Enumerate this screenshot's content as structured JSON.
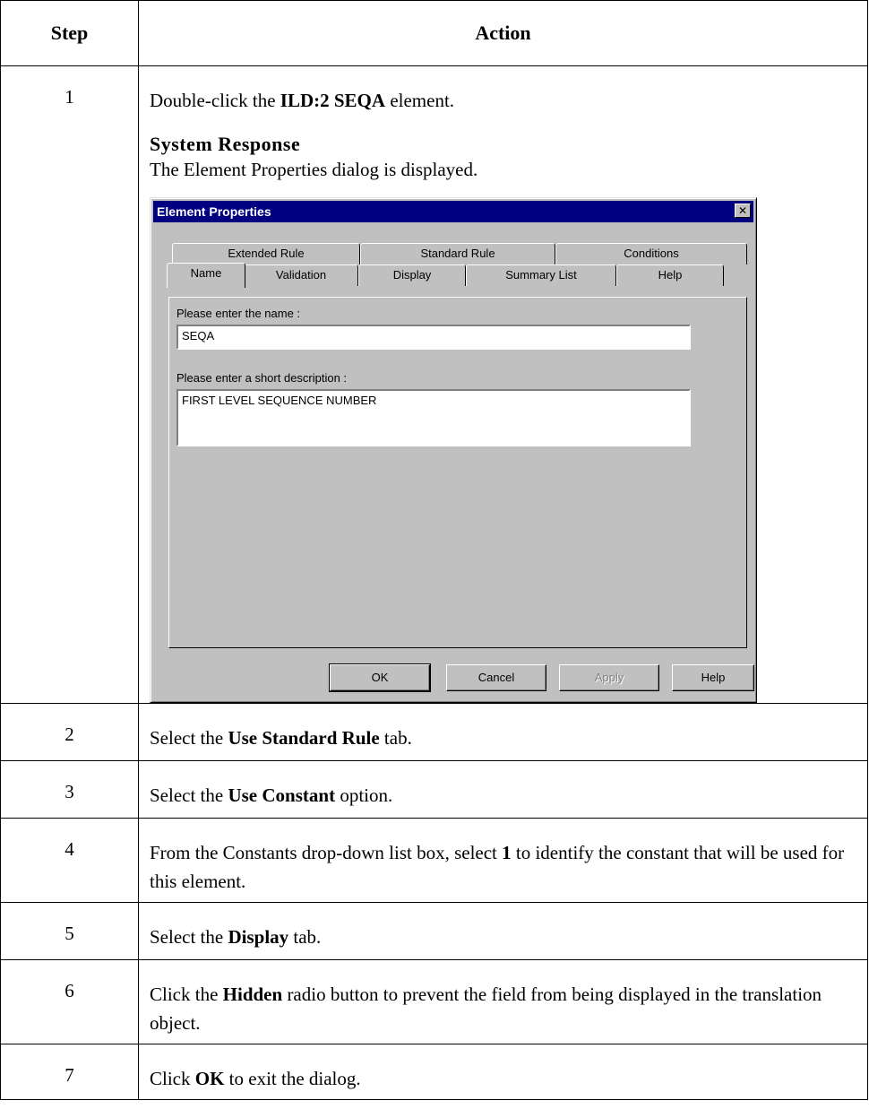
{
  "header": {
    "step": "Step",
    "action": "Action"
  },
  "step1": {
    "num": "1",
    "pre": "Double-click the ",
    "bold": "ILD:2 SEQA",
    "post": " element.",
    "system_response_heading": "System Response",
    "system_response_text": "The Element Properties dialog is displayed."
  },
  "dialog": {
    "title": "Element Properties",
    "close_glyph": "✕",
    "tabs_back": [
      "Extended Rule",
      "Standard Rule",
      "Conditions"
    ],
    "tabs_front": [
      "Name",
      "Validation",
      "Display",
      "Summary List",
      "Help"
    ],
    "selected_tab": "Name",
    "name_label": "Please enter the name :",
    "name_value": "SEQA",
    "desc_label": "Please enter a short description :",
    "desc_value": "FIRST LEVEL SEQUENCE NUMBER",
    "buttons": {
      "ok": "OK",
      "cancel": "Cancel",
      "apply": "Apply",
      "help": "Help"
    }
  },
  "steps": [
    {
      "num": "2",
      "pre": "Select the ",
      "bold": "Use Standard Rule",
      "post": " tab."
    },
    {
      "num": "3",
      "pre": "Select the ",
      "bold": "Use Constant",
      "post": " option."
    },
    {
      "num": "4",
      "pre": "From the Constants drop-down list box, select ",
      "bold": "1",
      "post": " to identify the constant that will be used for this element."
    },
    {
      "num": "5",
      "pre": "Select the ",
      "bold": "Display",
      "post": " tab."
    },
    {
      "num": "6",
      "pre": "Click the ",
      "bold": "Hidden",
      "post": " radio button to prevent the field from being displayed in the translation object."
    },
    {
      "num": "7",
      "pre": "Click ",
      "bold": "OK",
      "post": " to exit the dialog."
    }
  ]
}
